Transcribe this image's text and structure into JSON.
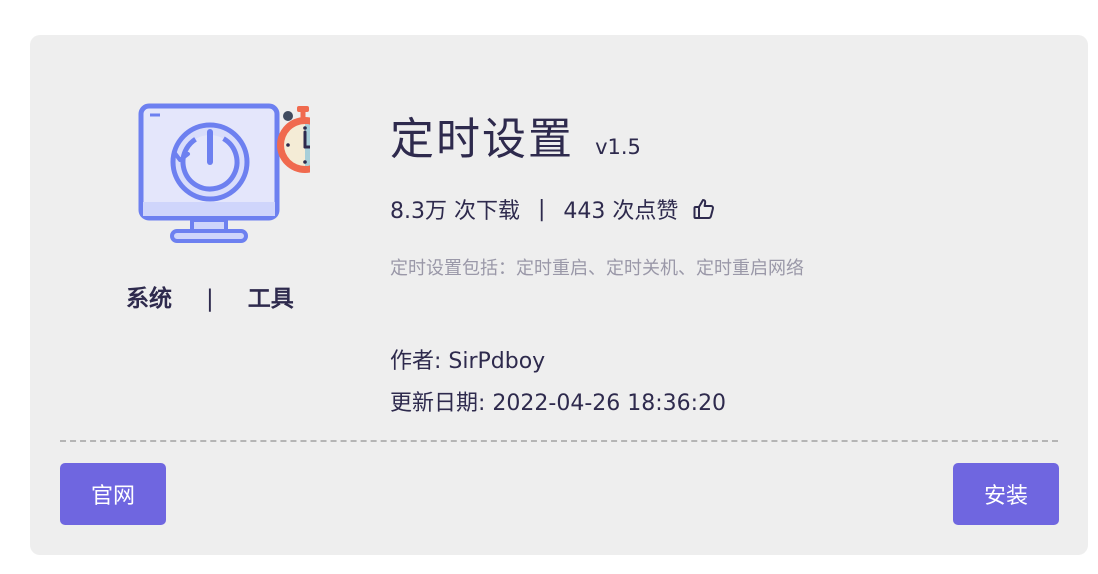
{
  "app": {
    "title": "定时设置",
    "version": "v1.5",
    "downloads": "8.3万 次下载",
    "likes": "443 次点赞",
    "stats_separator": "|",
    "description": "定时设置包括：定时重启、定时关机、定时重启网络",
    "author": "作者: SirPdboy",
    "updated": "更新日期: 2022-04-26 18:36:20"
  },
  "tags": {
    "category": "系统",
    "separator": "|",
    "type": "工具"
  },
  "buttons": {
    "website_label": "官网",
    "install_label": "安装"
  },
  "icons": {
    "app_icon": "monitor-power-timer-icon",
    "like_icon": "thumbs-up-icon"
  },
  "colors": {
    "accent": "#6f66e0",
    "card_bg": "#eeeeee",
    "text": "#2e2a4d",
    "muted_text": "#9a98a8"
  }
}
